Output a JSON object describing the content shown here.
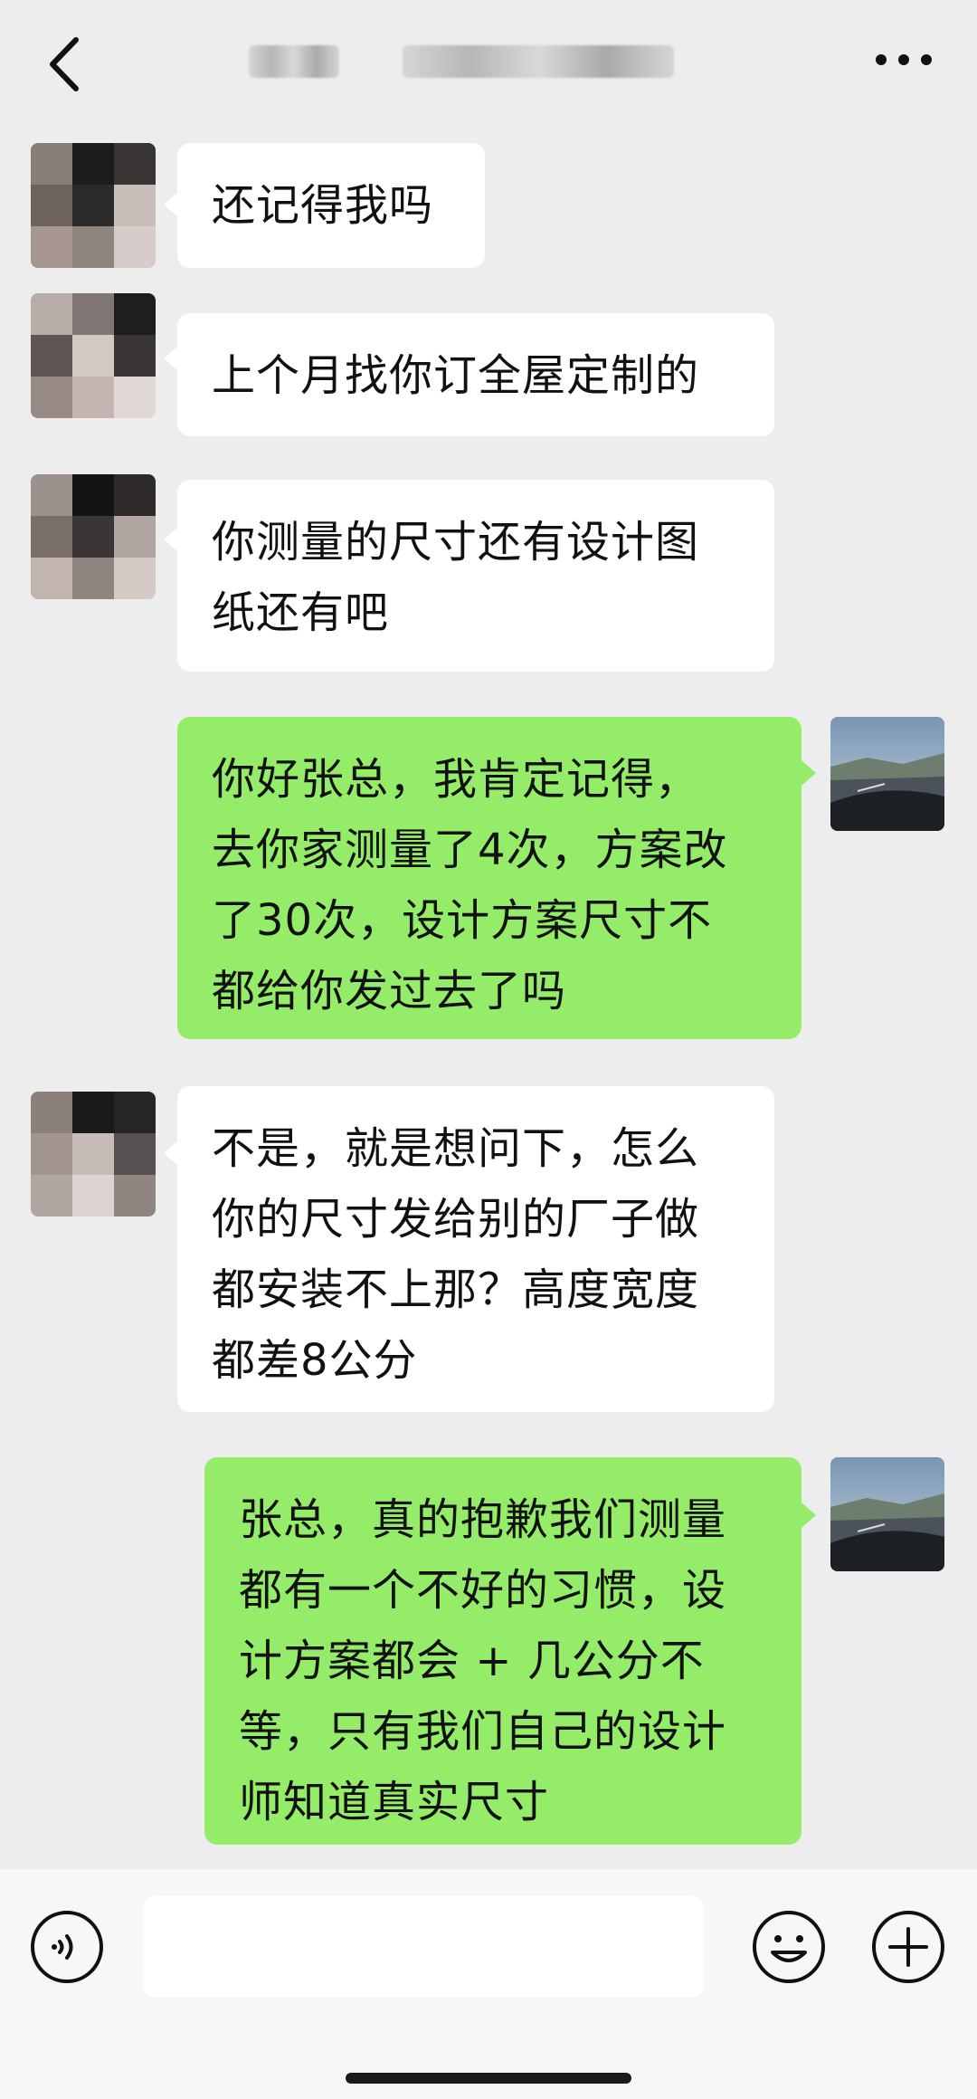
{
  "header": {
    "title": "",
    "back_icon": "chevron-left-icon",
    "more_icon": "more-dots-icon"
  },
  "colors": {
    "background": "#ededed",
    "incoming_bubble": "#ffffff",
    "outgoing_bubble": "#95ec69",
    "text": "#111111"
  },
  "messages": [
    {
      "sender": "contact",
      "lines": [
        "还记得我吗"
      ]
    },
    {
      "sender": "contact",
      "lines": [
        "上个月找你订全屋定制的"
      ]
    },
    {
      "sender": "contact",
      "lines": [
        "你测量的尺寸还有设计图",
        "纸还有吧"
      ]
    },
    {
      "sender": "me",
      "lines": [
        "你好张总，我肯定记得，",
        "去你家测量了4次，方案改",
        "了30次，设计方案尺寸不",
        "都给你发过去了吗"
      ]
    },
    {
      "sender": "contact",
      "lines": [
        "不是，就是想问下，怎么",
        "你的尺寸发给别的厂子做",
        "都安装不上那？高度宽度",
        "都差8公分"
      ]
    },
    {
      "sender": "me",
      "lines": [
        "张总，真的抱歉我们测量",
        "都有一个不好的习惯，设",
        "计方案都会 + 几公分不",
        "等，只有我们自己的设计",
        "师知道真实尺寸"
      ]
    }
  ],
  "input_bar": {
    "voice_icon": "voice-icon",
    "emoji_icon": "emoji-icon",
    "add_icon": "plus-icon"
  }
}
